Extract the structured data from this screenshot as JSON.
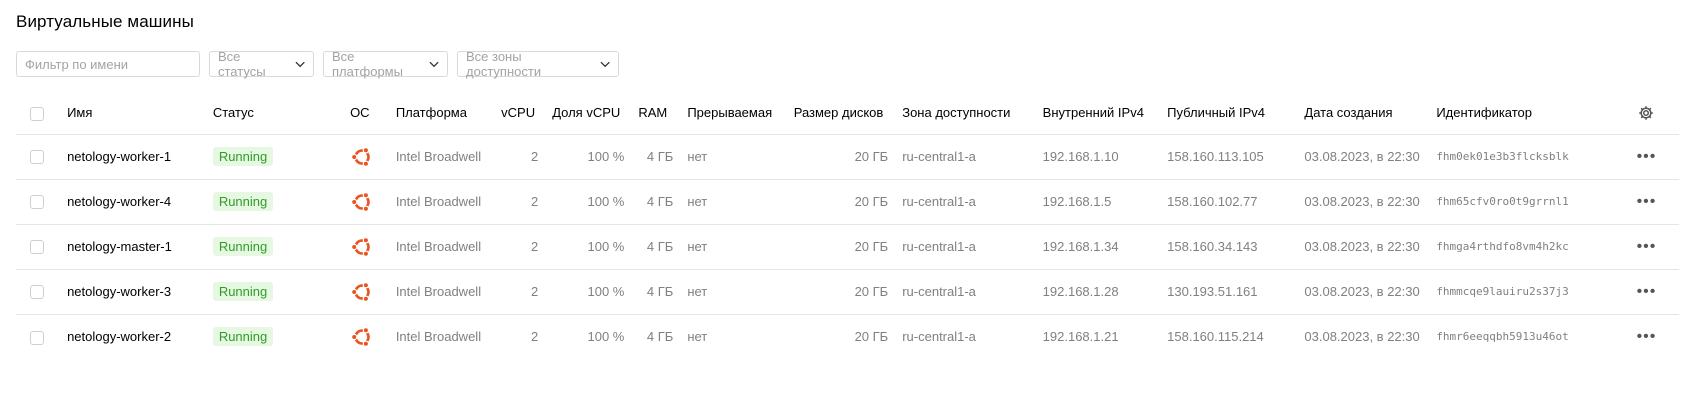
{
  "page": {
    "title": "Виртуальные машины"
  },
  "filters": {
    "name_placeholder": "Фильтр по имени",
    "status_label": "Все статусы",
    "platform_label": "Все платформы",
    "zone_label": "Все зоны доступности"
  },
  "table": {
    "columns": {
      "name": "Имя",
      "status": "Статус",
      "os": "ОС",
      "platform": "Платформа",
      "vcpu": "vCPU",
      "vcpu_share": "Доля vCPU",
      "ram": "RAM",
      "preemptible": "Прерываемая",
      "disk_size": "Размер дисков",
      "zone": "Зона доступности",
      "internal_ip": "Внутренний IPv4",
      "public_ip": "Публичный IPv4",
      "created": "Дата создания",
      "id": "Идентификатор"
    },
    "rows": [
      {
        "name": "netology-worker-1",
        "status": "Running",
        "os": "ubuntu-icon",
        "platform": "Intel Broadwell",
        "vcpu": "2",
        "vcpu_share": "100 %",
        "ram": "4 ГБ",
        "preemptible": "нет",
        "disk_size": "20 ГБ",
        "zone": "ru-central1-a",
        "internal_ip": "192.168.1.10",
        "public_ip": "158.160.113.105",
        "created": "03.08.2023, в 22:30",
        "id": "fhm0ek01e3b3flcksblk"
      },
      {
        "name": "netology-worker-4",
        "status": "Running",
        "os": "ubuntu-icon",
        "platform": "Intel Broadwell",
        "vcpu": "2",
        "vcpu_share": "100 %",
        "ram": "4 ГБ",
        "preemptible": "нет",
        "disk_size": "20 ГБ",
        "zone": "ru-central1-a",
        "internal_ip": "192.168.1.5",
        "public_ip": "158.160.102.77",
        "created": "03.08.2023, в 22:30",
        "id": "fhm65cfv0ro0t9grrnl1"
      },
      {
        "name": "netology-master-1",
        "status": "Running",
        "os": "ubuntu-icon",
        "platform": "Intel Broadwell",
        "vcpu": "2",
        "vcpu_share": "100 %",
        "ram": "4 ГБ",
        "preemptible": "нет",
        "disk_size": "20 ГБ",
        "zone": "ru-central1-a",
        "internal_ip": "192.168.1.34",
        "public_ip": "158.160.34.143",
        "created": "03.08.2023, в 22:30",
        "id": "fhmga4rthdfo8vm4h2kc"
      },
      {
        "name": "netology-worker-3",
        "status": "Running",
        "os": "ubuntu-icon",
        "platform": "Intel Broadwell",
        "vcpu": "2",
        "vcpu_share": "100 %",
        "ram": "4 ГБ",
        "preemptible": "нет",
        "disk_size": "20 ГБ",
        "zone": "ru-central1-a",
        "internal_ip": "192.168.1.28",
        "public_ip": "130.193.51.161",
        "created": "03.08.2023, в 22:30",
        "id": "fhmmcqe9lauiru2s37j3"
      },
      {
        "name": "netology-worker-2",
        "status": "Running",
        "os": "ubuntu-icon",
        "platform": "Intel Broadwell",
        "vcpu": "2",
        "vcpu_share": "100 %",
        "ram": "4 ГБ",
        "preemptible": "нет",
        "disk_size": "20 ГБ",
        "zone": "ru-central1-a",
        "internal_ip": "192.168.1.21",
        "public_ip": "158.160.115.214",
        "created": "03.08.2023, в 22:30",
        "id": "fhmr6eeqqbh5913u46ot"
      }
    ]
  },
  "colors": {
    "status_running_bg": "#e6f7e2",
    "status_running_text": "#2f9e28",
    "os_icon": "#e95420"
  }
}
